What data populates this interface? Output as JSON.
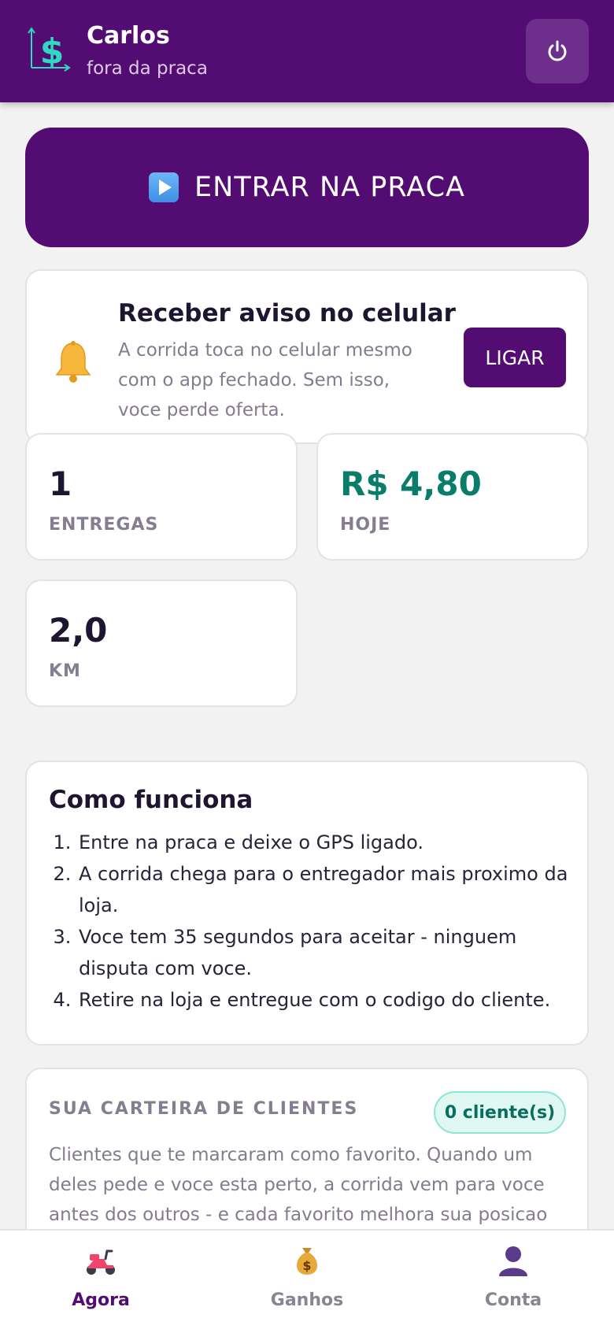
{
  "header": {
    "user_name": "Carlos",
    "status": "fora da praca",
    "logo_icon": "dollar-logo-icon",
    "power_icon": "power-icon"
  },
  "enter_button": {
    "label": "ENTRAR NA PRACA",
    "icon": "play-icon"
  },
  "notification_card": {
    "icon": "bell-icon",
    "title": "Receber aviso no celular",
    "description": "A corrida toca no celular mesmo com o app fechado. Sem isso, voce perde oferta.",
    "button_label": "LIGAR"
  },
  "stats": [
    {
      "value": "1",
      "label": "ENTREGAS"
    },
    {
      "value": "R$ 4,80",
      "label": "HOJE"
    },
    {
      "value": "2,0",
      "label": "KM"
    }
  ],
  "how_it_works": {
    "title": "Como funciona",
    "steps": [
      "Entre na praca e deixe o GPS ligado.",
      "A corrida chega para o entregador mais proximo da loja.",
      "Voce tem 35 segundos para aceitar - ninguem disputa com voce.",
      "Retire na loja e entregue com o codigo do cliente."
    ]
  },
  "wallet": {
    "title": "SUA CARTEIRA DE CLIENTES",
    "badge": "0 cliente(s)",
    "description": "Clientes que te marcaram como favorito. Quando um deles pede e voce esta perto, a corrida vem para voce antes dos outros - e cada favorito melhora sua posicao"
  },
  "bottom_nav": [
    {
      "label": "Agora",
      "icon": "scooter-icon",
      "active": true
    },
    {
      "label": "Ganhos",
      "icon": "money-bag-icon",
      "active": false
    },
    {
      "label": "Conta",
      "icon": "user-icon",
      "active": false
    }
  ],
  "colors": {
    "brand": "#530c72",
    "money": "#0a7d6a",
    "background": "#f3f2f2"
  }
}
